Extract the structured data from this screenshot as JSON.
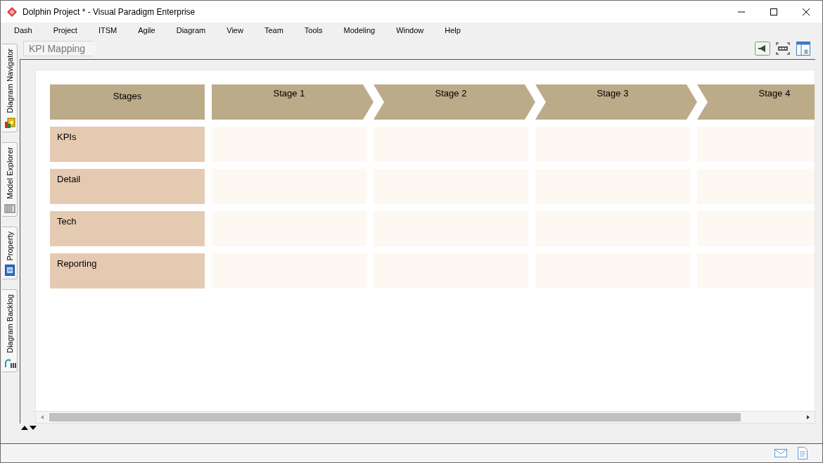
{
  "window": {
    "title": "Dolphin Project * - Visual Paradigm Enterprise"
  },
  "menu": [
    "Dash",
    "Project",
    "ITSM",
    "Agile",
    "Diagram",
    "View",
    "Team",
    "Tools",
    "Modeling",
    "Window",
    "Help"
  ],
  "side_tabs": [
    {
      "label": "Diagram Navigator",
      "kind": "navigator"
    },
    {
      "label": "Model Explorer",
      "kind": "explorer"
    },
    {
      "label": "Property",
      "kind": "property"
    },
    {
      "label": "Diagram Backlog",
      "kind": "backlog"
    }
  ],
  "breadcrumb": "KPI Mapping",
  "diagram": {
    "header": "Stages",
    "stages": [
      "Stage 1",
      "Stage 2",
      "Stage 3",
      "Stage 4"
    ],
    "rows": [
      {
        "label": "KPIs"
      },
      {
        "label": "Detail"
      },
      {
        "label": "Tech"
      },
      {
        "label": "Reporting"
      }
    ]
  }
}
